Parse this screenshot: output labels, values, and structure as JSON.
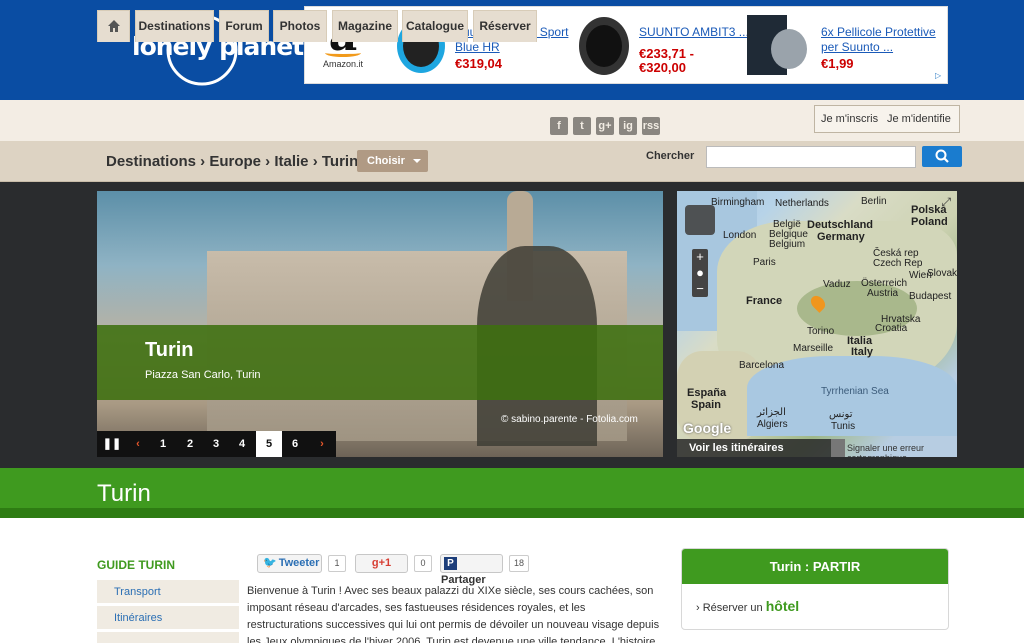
{
  "logo": {
    "text": "lonely planet"
  },
  "ad": {
    "amazon_label": "Amazon.it",
    "products": [
      {
        "title": "Suunto Ambit 3 Sport Blue HR",
        "price": "€319,04",
        "price2": ""
      },
      {
        "title": "SUUNTO AMBIT3 ...",
        "price": "€233,71 -",
        "price2": "€320,00"
      },
      {
        "title": "6x Pellicole Protettive per Suunto ...",
        "price": "€1,99",
        "price2": ""
      }
    ],
    "adchoices_icon": "adchoices-icon"
  },
  "nav": {
    "home_icon": "home-icon",
    "items": [
      "Destinations",
      "Forum",
      "Photos",
      "Magazine",
      "Catalogue",
      "Réserver"
    ],
    "social": [
      "f",
      "t",
      "g+",
      "ig",
      "rss"
    ],
    "signup": "Je m'inscris",
    "login": "Je m'identifie"
  },
  "breadcrumb": {
    "text": "Destinations › Europe › Italie › Turin",
    "choose": "Choisir"
  },
  "search": {
    "label": "Chercher",
    "placeholder": "",
    "button_icon": "search-icon"
  },
  "hero": {
    "title": "Turin",
    "subtitle": "Piazza San Carlo, Turin",
    "credit": "© sabino.parente - Fotolia.com",
    "pages": [
      "1",
      "2",
      "3",
      "4",
      "5",
      "6"
    ],
    "active_page": "5"
  },
  "map": {
    "labels": {
      "birmingham": "Birmingham",
      "netherlands": "Netherlands",
      "berlin": "Berlin",
      "polska": "Polska",
      "poland": "Poland",
      "london": "London",
      "belgie": "België",
      "belgique": "Belgique",
      "belgium": "Belgium",
      "deutschland": "Deutschland",
      "germany": "Germany",
      "paris": "Paris",
      "ceska": "Česká rep",
      "czech": "Czech Rep",
      "slovak": "Slovak",
      "vaduz": "Vaduz",
      "wien": "Wien",
      "osterreich": "Österreich",
      "austria": "Austria",
      "france": "France",
      "budapest": "Budapest",
      "hrvatska": "Hrvatska",
      "croatia": "Croatia",
      "torino": "Torino",
      "marseille": "Marseille",
      "italia": "Italia",
      "italy": "Italy",
      "barcelona": "Barcelona",
      "tyrrhenian": "Tyrrhenian Sea",
      "espana": "España",
      "spain": "Spain",
      "aljazair": "الجزائر",
      "algiers": "Algiers",
      "tunis_ar": "تونس",
      "tunis": "Tunis"
    },
    "google": "Google",
    "routes": "Voir les itinéraires",
    "error": "Signaler une erreur cartographique"
  },
  "page_title": "Turin",
  "guide": {
    "title": "GUIDE TURIN",
    "links": [
      "Transport",
      "Itinéraires",
      ""
    ]
  },
  "share": {
    "tweet": "Tweeter",
    "tweet_count": "1",
    "gplus": "+1",
    "gplus_count": "0",
    "partager": "Partager",
    "partager_count": "18"
  },
  "article": {
    "text": "Bienvenue à Turin ! Avec ses beaux palazzi du XIXe siècle, ses cours cachées, son imposant réseau d'arcades, ses fastueuses résidences royales, et les restructurations successives qui lui ont permis de dévoiler un nouveau visage depuis les Jeux olympiques de l'hiver 2006, Turin est devenue une ville tendance. L'histoire"
  },
  "partir": {
    "title": "Turin : PARTIR",
    "row_prefix": "Réserver un",
    "row_strong": "hôtel"
  },
  "colors": {
    "header": "#0a4da3",
    "green": "#3f9a1f",
    "accent_blue": "#1a7ccf"
  }
}
